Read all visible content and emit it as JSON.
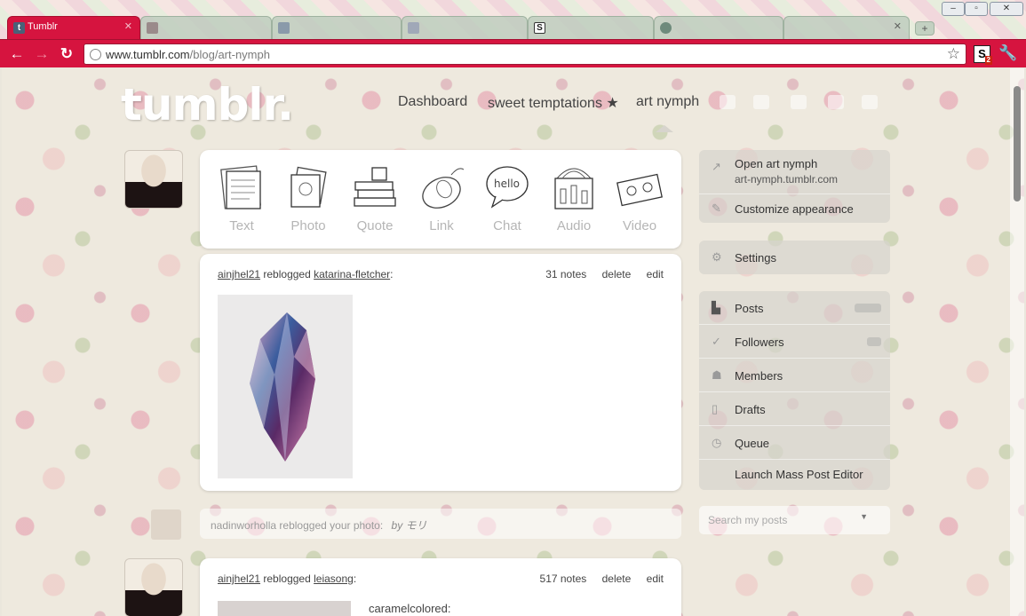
{
  "browser": {
    "tabs": [
      {
        "label": "Tumblr",
        "active": true,
        "icon": "tumblr-favicon"
      },
      {
        "label": "",
        "active": false,
        "icon": "image-favicon"
      },
      {
        "label": "",
        "active": false,
        "icon": "image-favicon"
      },
      {
        "label": "",
        "active": false,
        "icon": "image-favicon"
      },
      {
        "label": "",
        "active": false,
        "icon": "s-favicon"
      },
      {
        "label": "",
        "active": false,
        "icon": "globe-favicon"
      },
      {
        "label": "",
        "active": false,
        "icon": "image-favicon"
      }
    ],
    "url_host": "www.tumblr.com",
    "url_path": "/blog/art-nymph",
    "extension_badge": "2",
    "accent_color": "#d6143f"
  },
  "header": {
    "logo": "tumblr.",
    "nav": [
      "Dashboard",
      "sweet temptations ★",
      "art nymph"
    ]
  },
  "post_types": [
    {
      "label": "Text",
      "icon": "text-icon"
    },
    {
      "label": "Photo",
      "icon": "photo-icon"
    },
    {
      "label": "Quote",
      "icon": "quote-icon"
    },
    {
      "label": "Link",
      "icon": "link-icon"
    },
    {
      "label": "Chat",
      "icon": "chat-icon"
    },
    {
      "label": "Audio",
      "icon": "audio-icon"
    },
    {
      "label": "Video",
      "icon": "video-icon"
    }
  ],
  "posts": [
    {
      "user": "ainjhel21",
      "verb": "reblogged",
      "source": "katarina-fletcher",
      "notes": "31 notes",
      "delete": "delete",
      "edit": "edit"
    },
    {
      "user": "ainjhel21",
      "verb": "reblogged",
      "source": "leiasong",
      "notes": "517 notes",
      "delete": "delete",
      "edit": "edit",
      "snippet": "caramelcolored:"
    }
  ],
  "notification": {
    "user": "nadinworholla",
    "text": "reblogged",
    "suffix": "your photo:",
    "by": "by モリ"
  },
  "sidebar": {
    "open_label": "Open art nymph",
    "open_url": "art-nymph.tumblr.com",
    "customize": "Customize appearance",
    "settings": "Settings",
    "items": [
      "Posts",
      "Followers",
      "Members",
      "Drafts",
      "Queue",
      "Launch Mass Post Editor"
    ],
    "search_placeholder": "Search my posts"
  }
}
